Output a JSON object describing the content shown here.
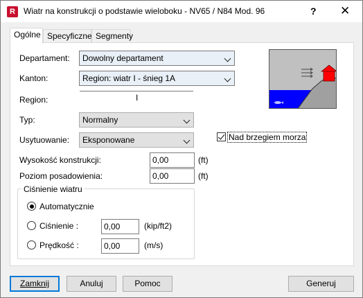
{
  "window": {
    "title": "Wiatr na konstrukcji o podstawie wieloboku - NV65 / N84 Mod. 96",
    "icon": "R",
    "help_glyph": "?",
    "close_glyph": "✕"
  },
  "tabs": [
    {
      "label": "Ogólne",
      "active": true
    },
    {
      "label": "Specyficzne",
      "active": false
    },
    {
      "label": "Segmenty",
      "active": false
    }
  ],
  "form": {
    "departament_label": "Departament:",
    "departament_value": "Dowolny departament",
    "kanton_label": "Kanton:",
    "kanton_value": "Region: wiatr I - śnieg 1A",
    "region_label": "Region:",
    "region_value": "I",
    "typ_label": "Typ:",
    "typ_value": "Normalny",
    "usytuowanie_label": "Usytuowanie:",
    "usytuowanie_value": "Eksponowane",
    "nad_brzegiem_label": "Nad brzegiem morza",
    "nad_brzegiem_checked": true,
    "wysokosc_label": "Wysokość konstrukcji:",
    "wysokosc_value": "0,00",
    "wysokosc_unit": "(ft)",
    "poziom_label": "Poziom posadowienia:",
    "poziom_value": "0,00",
    "poziom_unit": "(ft)"
  },
  "pressure": {
    "group_title": "Ciśnienie wiatru",
    "auto_label": "Automatycznie",
    "auto_selected": true,
    "cisnienie_label": "Ciśnienie :",
    "cisnienie_value": "0,00",
    "cisnienie_unit": "(kip/ft2)",
    "predkosc_label": "Prędkość :",
    "predkosc_value": "0,00",
    "predkosc_unit": "(m/s)"
  },
  "buttons": {
    "close": "Zamknij",
    "cancel": "Anuluj",
    "help": "Pomoc",
    "generate": "Generuj"
  },
  "colors": {
    "accent": "#0078d7",
    "brand": "#c8102e",
    "sky": "#c0c0c0",
    "sea": "#0000ff",
    "ground": "#a0a0a0",
    "house": "#ff0000"
  }
}
